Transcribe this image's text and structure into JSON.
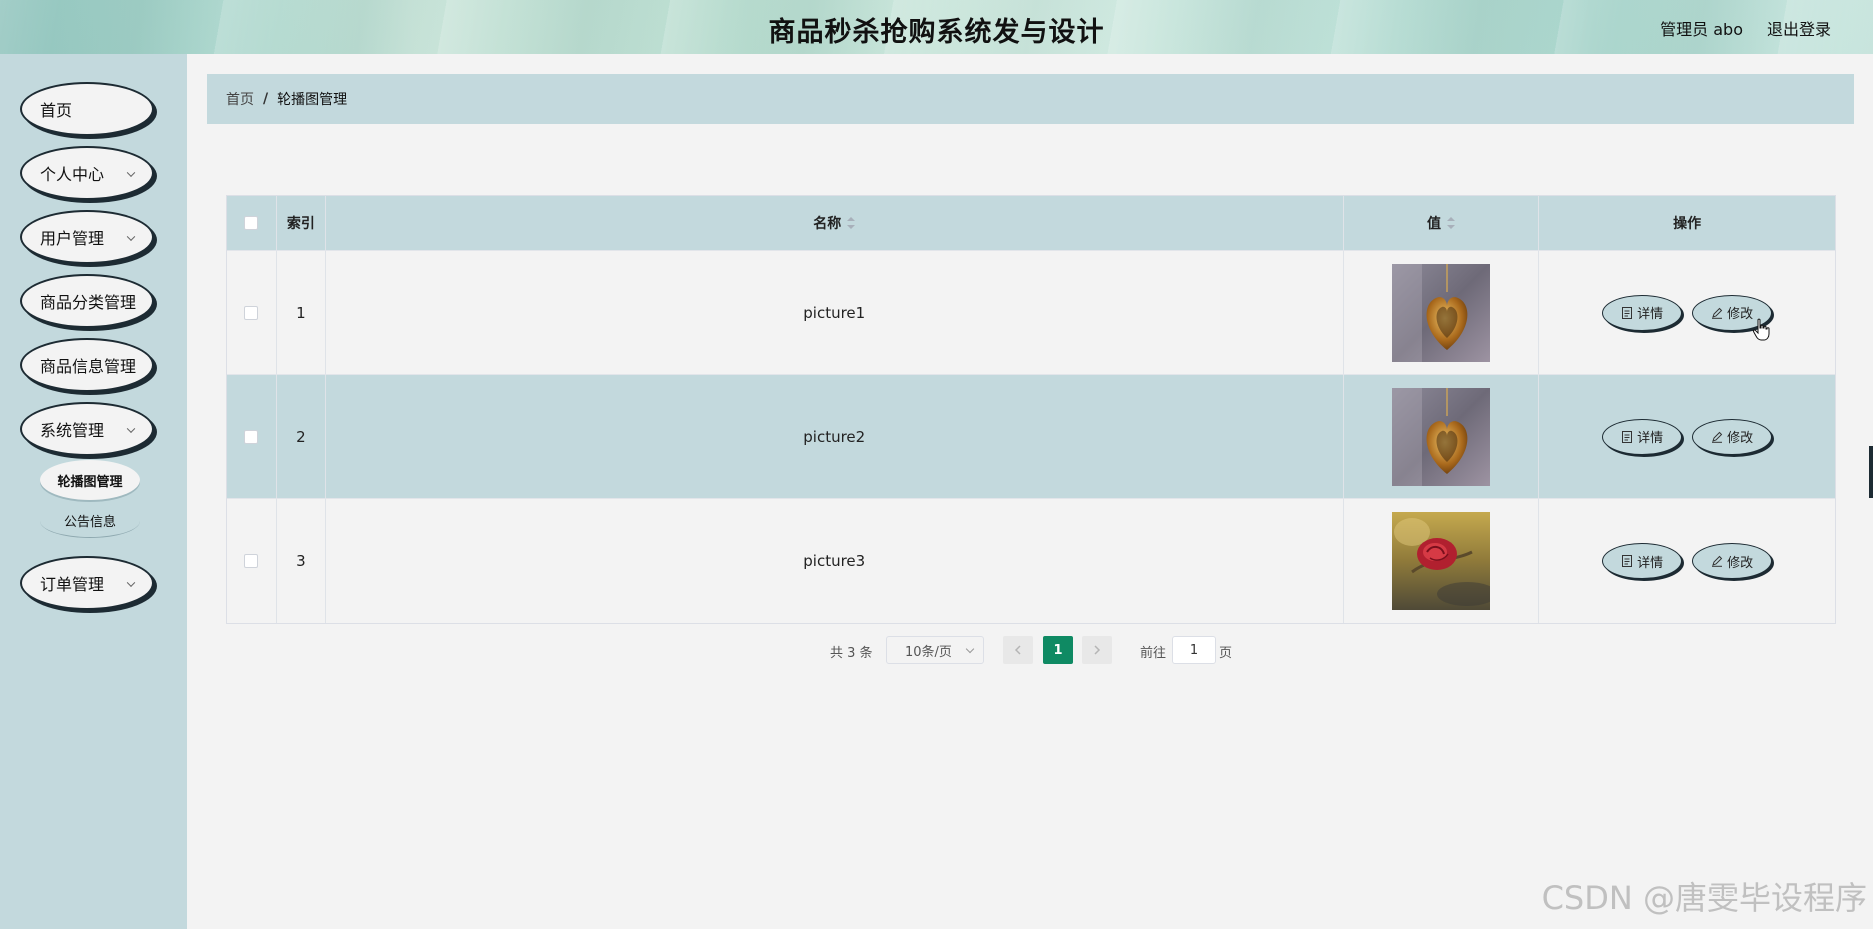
{
  "header": {
    "title": "商品秒杀抢购系统发与设计",
    "user": "管理员 abo",
    "logout": "退出登录"
  },
  "sidebar": {
    "items": [
      {
        "label": "首页",
        "expandable": false
      },
      {
        "label": "个人中心",
        "expandable": true
      },
      {
        "label": "用户管理",
        "expandable": true
      },
      {
        "label": "商品分类管理",
        "expandable": false
      },
      {
        "label": "商品信息管理",
        "expandable": false
      },
      {
        "label": "系统管理",
        "expandable": true
      },
      {
        "label": "订单管理",
        "expandable": true
      }
    ],
    "sub_items": [
      {
        "label": "轮播图管理",
        "active": true
      },
      {
        "label": "公告信息",
        "active": false
      }
    ]
  },
  "breadcrumb": {
    "home": "首页",
    "separator": "/",
    "current": "轮播图管理"
  },
  "table": {
    "columns": {
      "index": "索引",
      "name": "名称",
      "value": "值",
      "ops": "操作"
    },
    "rows": [
      {
        "index": "1",
        "name": "picture1",
        "image": "gold-heart-pendant",
        "detail": "详情",
        "edit": "修改"
      },
      {
        "index": "2",
        "name": "picture2",
        "image": "gold-heart-pendant",
        "detail": "详情",
        "edit": "修改"
      },
      {
        "index": "3",
        "name": "picture3",
        "image": "red-rose",
        "detail": "详情",
        "edit": "修改"
      }
    ]
  },
  "pagination": {
    "total": "共 3 条",
    "page_size": "10条/页",
    "current_page": "1",
    "goto_label": "前往",
    "goto_value": "1",
    "page_suffix": "页"
  },
  "watermark": "CSDN @唐雯毕设程序",
  "colors": {
    "panel": "#c3d9dd",
    "active_page": "#0f8a63",
    "background": "#f3f3f3"
  }
}
